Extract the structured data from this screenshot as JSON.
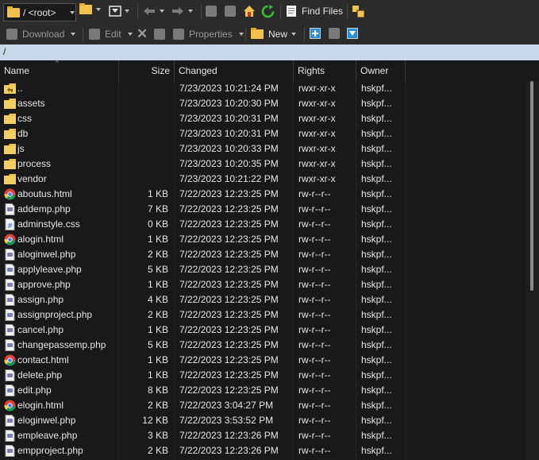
{
  "toolbar": {
    "root_label": "/ <root>",
    "find_files": "Find Files",
    "download": "Download",
    "edit": "Edit",
    "properties": "Properties",
    "new": "New"
  },
  "path": "/",
  "columns": {
    "name": "Name",
    "size": "Size",
    "changed": "Changed",
    "rights": "Rights",
    "owner": "Owner"
  },
  "files": [
    {
      "name": "..",
      "size": "",
      "changed": "7/23/2023 10:21:24 PM",
      "rights": "rwxr-xr-x",
      "owner": "hskpf...",
      "icon": "parent-folder"
    },
    {
      "name": "assets",
      "size": "",
      "changed": "7/23/2023 10:20:30 PM",
      "rights": "rwxr-xr-x",
      "owner": "hskpf...",
      "icon": "folder"
    },
    {
      "name": "css",
      "size": "",
      "changed": "7/23/2023 10:20:31 PM",
      "rights": "rwxr-xr-x",
      "owner": "hskpf...",
      "icon": "folder"
    },
    {
      "name": "db",
      "size": "",
      "changed": "7/23/2023 10:20:31 PM",
      "rights": "rwxr-xr-x",
      "owner": "hskpf...",
      "icon": "folder"
    },
    {
      "name": "js",
      "size": "",
      "changed": "7/23/2023 10:20:33 PM",
      "rights": "rwxr-xr-x",
      "owner": "hskpf...",
      "icon": "folder"
    },
    {
      "name": "process",
      "size": "",
      "changed": "7/23/2023 10:20:35 PM",
      "rights": "rwxr-xr-x",
      "owner": "hskpf...",
      "icon": "folder"
    },
    {
      "name": "vendor",
      "size": "",
      "changed": "7/23/2023 10:21:22 PM",
      "rights": "rwxr-xr-x",
      "owner": "hskpf...",
      "icon": "folder"
    },
    {
      "name": "aboutus.html",
      "size": "1 KB",
      "changed": "7/22/2023 12:23:25 PM",
      "rights": "rw-r--r--",
      "owner": "hskpf...",
      "icon": "chrome"
    },
    {
      "name": "addemp.php",
      "size": "7 KB",
      "changed": "7/22/2023 12:23:25 PM",
      "rights": "rw-r--r--",
      "owner": "hskpf...",
      "icon": "php"
    },
    {
      "name": "adminstyle.css",
      "size": "0 KB",
      "changed": "7/22/2023 12:23:25 PM",
      "rights": "rw-r--r--",
      "owner": "hskpf...",
      "icon": "css"
    },
    {
      "name": "alogin.html",
      "size": "1 KB",
      "changed": "7/22/2023 12:23:25 PM",
      "rights": "rw-r--r--",
      "owner": "hskpf...",
      "icon": "chrome"
    },
    {
      "name": "aloginwel.php",
      "size": "2 KB",
      "changed": "7/22/2023 12:23:25 PM",
      "rights": "rw-r--r--",
      "owner": "hskpf...",
      "icon": "php"
    },
    {
      "name": "applyleave.php",
      "size": "5 KB",
      "changed": "7/22/2023 12:23:25 PM",
      "rights": "rw-r--r--",
      "owner": "hskpf...",
      "icon": "php"
    },
    {
      "name": "approve.php",
      "size": "1 KB",
      "changed": "7/22/2023 12:23:25 PM",
      "rights": "rw-r--r--",
      "owner": "hskpf...",
      "icon": "php"
    },
    {
      "name": "assign.php",
      "size": "4 KB",
      "changed": "7/22/2023 12:23:25 PM",
      "rights": "rw-r--r--",
      "owner": "hskpf...",
      "icon": "php"
    },
    {
      "name": "assignproject.php",
      "size": "2 KB",
      "changed": "7/22/2023 12:23:25 PM",
      "rights": "rw-r--r--",
      "owner": "hskpf...",
      "icon": "php"
    },
    {
      "name": "cancel.php",
      "size": "1 KB",
      "changed": "7/22/2023 12:23:25 PM",
      "rights": "rw-r--r--",
      "owner": "hskpf...",
      "icon": "php"
    },
    {
      "name": "changepassemp.php",
      "size": "5 KB",
      "changed": "7/22/2023 12:23:25 PM",
      "rights": "rw-r--r--",
      "owner": "hskpf...",
      "icon": "php"
    },
    {
      "name": "contact.html",
      "size": "1 KB",
      "changed": "7/22/2023 12:23:25 PM",
      "rights": "rw-r--r--",
      "owner": "hskpf...",
      "icon": "chrome"
    },
    {
      "name": "delete.php",
      "size": "1 KB",
      "changed": "7/22/2023 12:23:25 PM",
      "rights": "rw-r--r--",
      "owner": "hskpf...",
      "icon": "php"
    },
    {
      "name": "edit.php",
      "size": "8 KB",
      "changed": "7/22/2023 12:23:25 PM",
      "rights": "rw-r--r--",
      "owner": "hskpf...",
      "icon": "php"
    },
    {
      "name": "elogin.html",
      "size": "2 KB",
      "changed": "7/22/2023 3:04:27 PM",
      "rights": "rw-r--r--",
      "owner": "hskpf...",
      "icon": "chrome"
    },
    {
      "name": "eloginwel.php",
      "size": "12 KB",
      "changed": "7/22/2023 3:53:52 PM",
      "rights": "rw-r--r--",
      "owner": "hskpf...",
      "icon": "php"
    },
    {
      "name": "empleave.php",
      "size": "3 KB",
      "changed": "7/22/2023 12:23:26 PM",
      "rights": "rw-r--r--",
      "owner": "hskpf...",
      "icon": "php"
    },
    {
      "name": "empproject.php",
      "size": "2 KB",
      "changed": "7/22/2023 12:23:26 PM",
      "rights": "rw-r--r--",
      "owner": "hskpf...",
      "icon": "php"
    }
  ]
}
